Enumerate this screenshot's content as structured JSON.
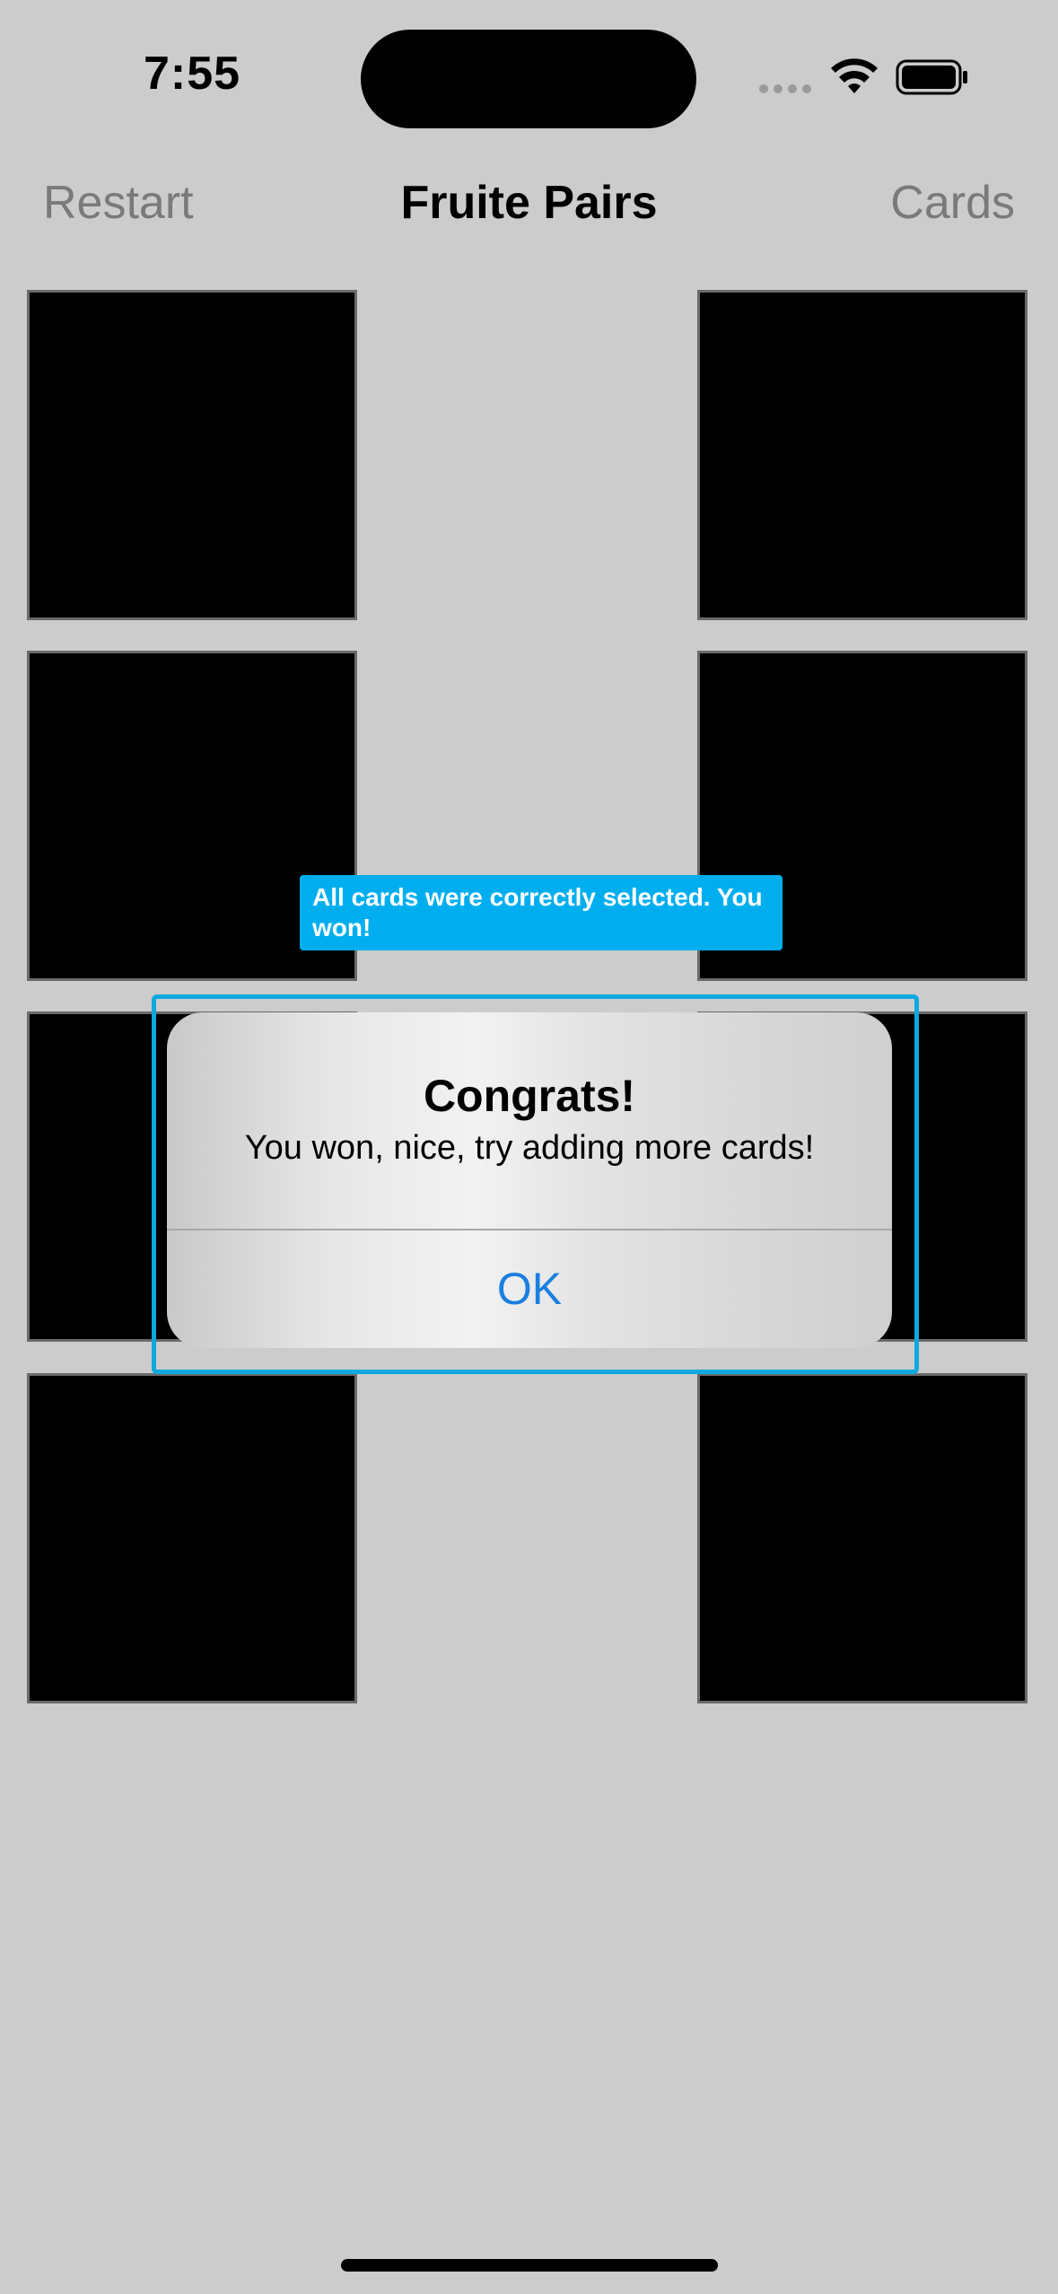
{
  "status_bar": {
    "time": "7:55",
    "icons": [
      "signal-dots-icon",
      "wifi-icon",
      "battery-icon"
    ]
  },
  "nav": {
    "left_label": "Restart",
    "title": "Fruite Pairs",
    "right_label": "Cards"
  },
  "cards": {
    "count": 8,
    "state": "face-down"
  },
  "accessibility_tooltip": {
    "text": "All cards were correctly selected. You won!"
  },
  "alert": {
    "title": "Congrats!",
    "message": "You won, nice, try adding more cards!",
    "button_label": "OK"
  },
  "colors": {
    "background": "#cccccc",
    "card": "#000000",
    "tooltip": "#00aeef",
    "alert_button": "#1a7fe0",
    "nav_button": "#7a7a7a"
  }
}
